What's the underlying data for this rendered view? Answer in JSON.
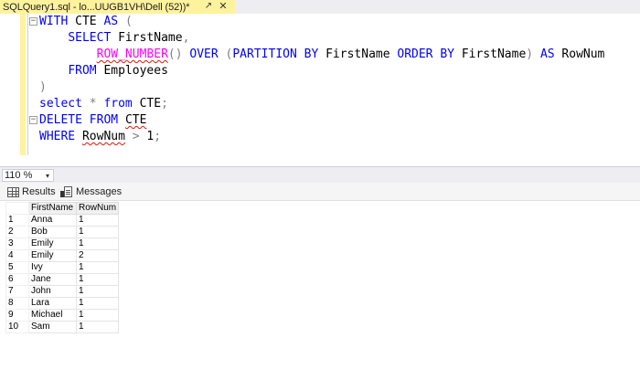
{
  "tab": {
    "title": "SQLQuery1.sql - lo...UUGB1VH\\Dell (52))*",
    "pin_icon": "pin-icon",
    "close_icon": "close-icon",
    "accent": "#fff29d"
  },
  "editor": {
    "lines": [
      {
        "tokens": [
          {
            "t": "WITH",
            "c": "kw"
          },
          {
            "t": " CTE "
          },
          {
            "t": "AS",
            "c": "kw"
          },
          {
            "t": " "
          },
          {
            "t": "(",
            "c": "op"
          }
        ]
      },
      {
        "tokens": [
          {
            "t": "    "
          },
          {
            "t": "SELECT",
            "c": "kw"
          },
          {
            "t": " FirstName"
          },
          {
            "t": ",",
            "c": "op"
          }
        ]
      },
      {
        "tokens": [
          {
            "t": "        "
          },
          {
            "t": "ROW_NUMBER",
            "c": "fn sq"
          },
          {
            "t": "()",
            "c": "op"
          },
          {
            "t": " "
          },
          {
            "t": "OVER",
            "c": "kw"
          },
          {
            "t": " "
          },
          {
            "t": "(",
            "c": "op"
          },
          {
            "t": "PARTITION BY",
            "c": "kw"
          },
          {
            "t": " FirstName "
          },
          {
            "t": "ORDER BY",
            "c": "kw"
          },
          {
            "t": " FirstName"
          },
          {
            "t": ")",
            "c": "op"
          },
          {
            "t": " "
          },
          {
            "t": "AS",
            "c": "kw"
          },
          {
            "t": " RowNum"
          }
        ]
      },
      {
        "tokens": [
          {
            "t": "    "
          },
          {
            "t": "FROM",
            "c": "kw"
          },
          {
            "t": " Employees"
          }
        ]
      },
      {
        "tokens": [
          {
            "t": ")",
            "c": "op"
          }
        ]
      },
      {
        "tokens": [
          {
            "t": "select",
            "c": "kw"
          },
          {
            "t": " "
          },
          {
            "t": "*",
            "c": "op"
          },
          {
            "t": " "
          },
          {
            "t": "from",
            "c": "kw"
          },
          {
            "t": " CTE"
          },
          {
            "t": ";",
            "c": "op"
          }
        ]
      },
      {
        "tokens": [
          {
            "t": "DELETE",
            "c": "kw"
          },
          {
            "t": " "
          },
          {
            "t": "FROM",
            "c": "kw"
          },
          {
            "t": " "
          },
          {
            "t": "CTE",
            "c": "sq"
          }
        ]
      },
      {
        "tokens": [
          {
            "t": "WHERE",
            "c": "kw"
          },
          {
            "t": " "
          },
          {
            "t": "RowNum",
            "c": "sq"
          },
          {
            "t": " "
          },
          {
            "t": ">",
            "c": "op"
          },
          {
            "t": " 1"
          },
          {
            "t": ";",
            "c": "op"
          }
        ]
      }
    ]
  },
  "zoom": {
    "value": "110 %",
    "arrow_icon": "chevron-down-icon"
  },
  "result_tabs": [
    {
      "label": "Results",
      "icon": "grid-icon"
    },
    {
      "label": "Messages",
      "icon": "messages-icon"
    }
  ],
  "results": {
    "columns": [
      "FirstName",
      "RowNum"
    ],
    "rows": [
      [
        "1",
        "Anna",
        "1"
      ],
      [
        "2",
        "Bob",
        "1"
      ],
      [
        "3",
        "Emily",
        "1"
      ],
      [
        "4",
        "Emily",
        "2"
      ],
      [
        "5",
        "Ivy",
        "1"
      ],
      [
        "6",
        "Jane",
        "1"
      ],
      [
        "7",
        "John",
        "1"
      ],
      [
        "8",
        "Lara",
        "1"
      ],
      [
        "9",
        "Michael",
        "1"
      ],
      [
        "10",
        "Sam",
        "1"
      ]
    ]
  }
}
